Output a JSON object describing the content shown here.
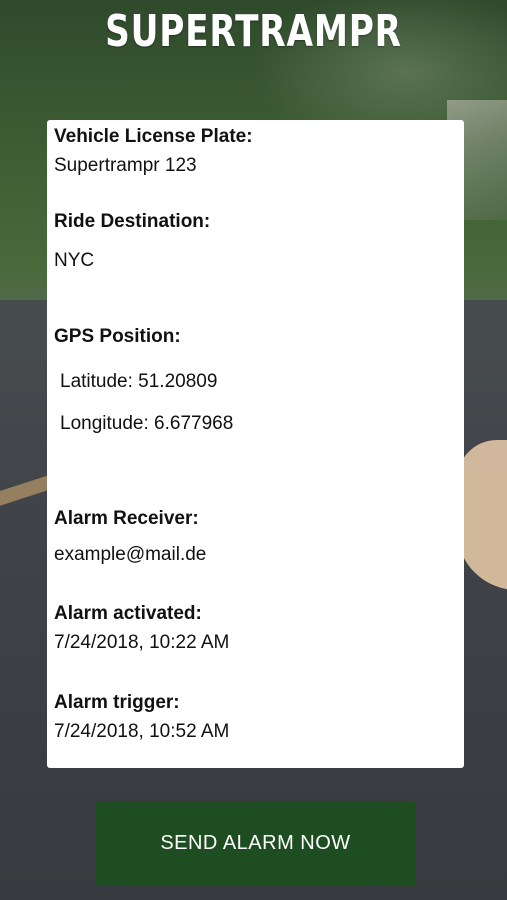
{
  "app": {
    "title": "SUPERTRAMPR"
  },
  "details": {
    "plate_label": "Vehicle License Plate:",
    "plate_value": "Supertrampr 123",
    "destination_label": "Ride Destination:",
    "destination_value": "NYC",
    "gps_label": "GPS Position:",
    "latitude": "Latitude: 51.20809",
    "longitude": "Longitude: 6.677968",
    "receiver_label": "Alarm Receiver:",
    "receiver_value": "example@mail.de",
    "activated_label": "Alarm activated:",
    "activated_value": "7/24/2018, 10:22 AM",
    "trigger_label": "Alarm trigger:",
    "trigger_value": "7/24/2018, 10:52 AM"
  },
  "actions": {
    "send_label": "SEND ALARM NOW"
  }
}
